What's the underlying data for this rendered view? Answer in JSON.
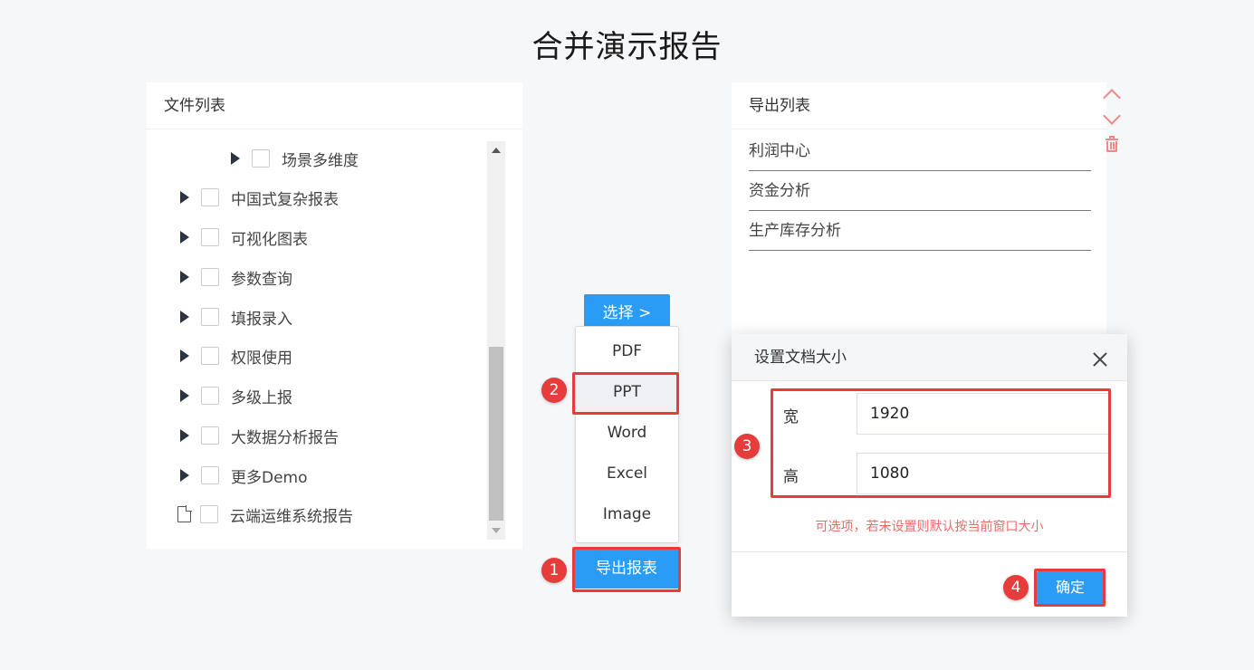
{
  "page": {
    "title": "合并演示报告"
  },
  "file_list": {
    "header": "文件列表",
    "items": [
      {
        "label": "场景多维度",
        "type": "folder"
      },
      {
        "label": "中国式复杂报表",
        "type": "folder"
      },
      {
        "label": "可视化图表",
        "type": "folder"
      },
      {
        "label": "参数查询",
        "type": "folder"
      },
      {
        "label": "填报录入",
        "type": "folder"
      },
      {
        "label": "权限使用",
        "type": "folder"
      },
      {
        "label": "多级上报",
        "type": "folder"
      },
      {
        "label": "大数据分析报告",
        "type": "folder"
      },
      {
        "label": "更多Demo",
        "type": "folder"
      },
      {
        "label": "云端运维系统报告",
        "type": "file"
      }
    ]
  },
  "actions": {
    "select_label": "选择 >",
    "export_label": "导出报表",
    "formats": [
      "PDF",
      "PPT",
      "Word",
      "Excel",
      "Image"
    ],
    "selected_format": "PPT"
  },
  "export_list": {
    "header": "导出列表",
    "items": [
      "利润中心",
      "资金分析",
      "生产库存分析"
    ]
  },
  "dialog": {
    "title": "设置文档大小",
    "width_label": "宽",
    "width_value": "1920",
    "height_label": "高",
    "height_value": "1080",
    "hint": "可选项，若未设置则默认按当前窗口大小",
    "confirm_label": "确定"
  },
  "markers": [
    "1",
    "2",
    "3",
    "4"
  ],
  "colors": {
    "primary": "#2a9cf5",
    "highlight": "#e63c3c",
    "hint": "#ee6a6a",
    "tool_icon": "#ec8a8a"
  }
}
